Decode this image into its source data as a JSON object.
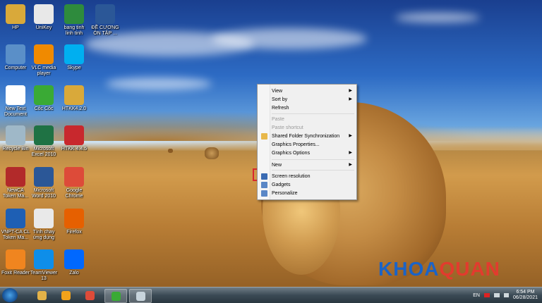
{
  "desktop_icons": [
    {
      "label": "HP",
      "icon": "folder-icon",
      "color": "#d9a93a"
    },
    {
      "label": "UniKey",
      "icon": "unikey-icon",
      "color": "#e8e8e8"
    },
    {
      "label": "bang tinh\nlinh tinh",
      "icon": "excel-file-icon",
      "color": "#2e8b3d"
    },
    {
      "label": "ĐỀ CƯƠNG\nÔN TẬP ...",
      "icon": "word-file-icon",
      "color": "#2b5797"
    },
    {
      "label": "Computer",
      "icon": "computer-icon",
      "color": "#5a8fc8"
    },
    {
      "label": "VLC media\nplayer",
      "icon": "vlc-icon",
      "color": "#f08a00"
    },
    {
      "label": "Skype",
      "icon": "skype-icon",
      "color": "#00aff0"
    },
    {
      "label": "New Text\nDocument",
      "icon": "text-document-icon",
      "color": "#ffffff"
    },
    {
      "label": "Cốc Cốc",
      "icon": "coccoc-icon",
      "color": "#3aaa35"
    },
    {
      "label": "HTKK4.2.0",
      "icon": "folder-icon",
      "color": "#d9a93a"
    },
    {
      "label": "Recycle Bin",
      "icon": "recycle-bin-icon",
      "color": "#9fb8c8"
    },
    {
      "label": "Microsoft\nExcel 2010",
      "icon": "excel-icon",
      "color": "#1f7244"
    },
    {
      "label": "HTKK 4.4.5",
      "icon": "htkk-icon",
      "color": "#c8282d"
    },
    {
      "label": "NewCA\nToken Ma...",
      "icon": "newca-icon",
      "color": "#b22a2a"
    },
    {
      "label": "Microsoft\nWord 2010",
      "icon": "word-icon",
      "color": "#2b5797"
    },
    {
      "label": "Google\nChrome",
      "icon": "chrome-icon",
      "color": "#dd4b39"
    },
    {
      "label": "VNPT-CA CL\nToken Ma...",
      "icon": "vnpt-icon",
      "color": "#1e5fb4"
    },
    {
      "label": "Tính chay\nứng dụng",
      "icon": "app-grid-icon",
      "color": "#e9e9e9"
    },
    {
      "label": "Firefox",
      "icon": "firefox-icon",
      "color": "#e66000"
    },
    {
      "label": "Foxit Reader",
      "icon": "foxit-icon",
      "color": "#f0851f"
    },
    {
      "label": "TeamViewer\n13",
      "icon": "teamviewer-icon",
      "color": "#0e8ee9"
    },
    {
      "label": "Zalo",
      "icon": "zalo-icon",
      "color": "#0068ff"
    }
  ],
  "context_menu": {
    "items": [
      {
        "label": "View",
        "submenu": true,
        "disabled": false
      },
      {
        "label": "Sort by",
        "submenu": true,
        "disabled": false
      },
      {
        "label": "Refresh",
        "submenu": false,
        "disabled": false
      },
      {
        "label": "Paste",
        "submenu": false,
        "disabled": true
      },
      {
        "label": "Paste shortcut",
        "submenu": false,
        "disabled": true
      },
      {
        "label": "Shared Folder Synchronization",
        "submenu": true,
        "disabled": false,
        "icon": "sync-icon"
      },
      {
        "label": "Graphics Properties...",
        "submenu": false,
        "disabled": false
      },
      {
        "label": "Graphics Options",
        "submenu": true,
        "disabled": false
      },
      {
        "label": "New",
        "submenu": true,
        "disabled": false
      },
      {
        "label": "Screen resolution",
        "submenu": false,
        "disabled": false,
        "icon": "display-icon",
        "highlighted": true
      },
      {
        "label": "Gadgets",
        "submenu": false,
        "disabled": false,
        "icon": "gadgets-icon"
      },
      {
        "label": "Personalize",
        "submenu": false,
        "disabled": false,
        "icon": "personalize-icon"
      }
    ],
    "submenu_arrow": "▶",
    "highlight_color": "#d9272e"
  },
  "taskbar": {
    "pinned": [
      {
        "name": "explorer",
        "icon": "folder-icon",
        "color": "#e3b248"
      },
      {
        "name": "media-player",
        "icon": "media-player-icon",
        "color": "#f2a21b"
      },
      {
        "name": "chrome",
        "icon": "chrome-icon",
        "color": "#dd4b39"
      },
      {
        "name": "coccoc",
        "icon": "coccoc-icon",
        "color": "#3aaa35",
        "active": true
      },
      {
        "name": "snipping",
        "icon": "snipping-icon",
        "color": "#c8d4dc",
        "active": true
      }
    ],
    "language": "EN",
    "time": "6:54 PM",
    "date": "06/28/2021"
  },
  "watermark": {
    "part1": "KHOA",
    "part2": "QUAN",
    "color1": "#1b63c6",
    "color2": "#e23b2e"
  }
}
